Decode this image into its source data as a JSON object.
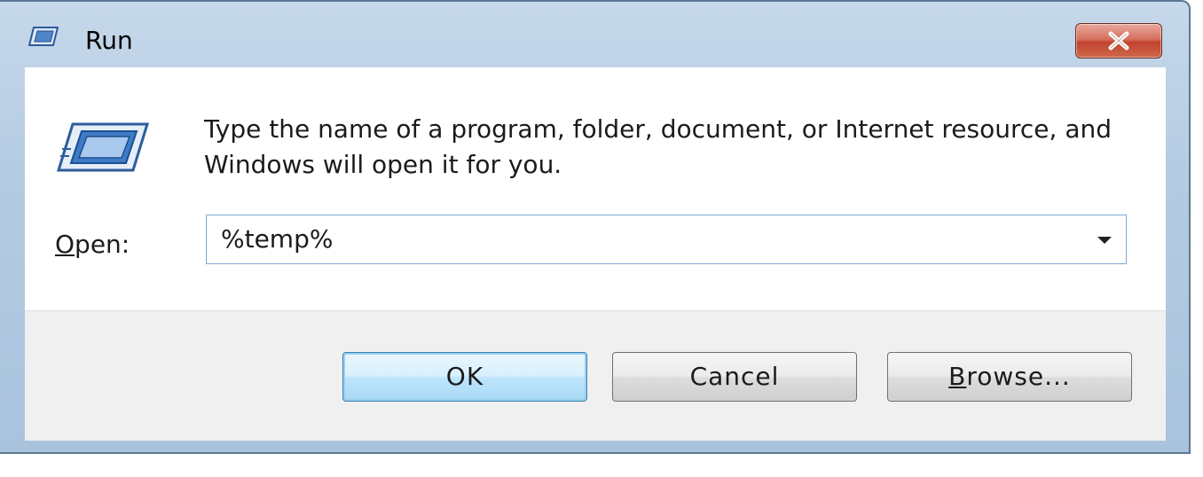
{
  "window": {
    "title": "Run",
    "title_icon": "run-icon",
    "close_icon": "close-icon"
  },
  "dialog": {
    "description": "Type the name of a program, folder, document, or Internet resource, and Windows will open it for you.",
    "open_label_mnemonic": "O",
    "open_label_rest": "pen:",
    "open_value": "%temp%"
  },
  "buttons": {
    "ok": "OK",
    "cancel": "Cancel",
    "browse_mnemonic": "B",
    "browse_rest": "rowse..."
  },
  "colors": {
    "close_button": "#c14330",
    "default_button_border": "#3c7fb1",
    "combo_border": "#7ea9d1"
  }
}
